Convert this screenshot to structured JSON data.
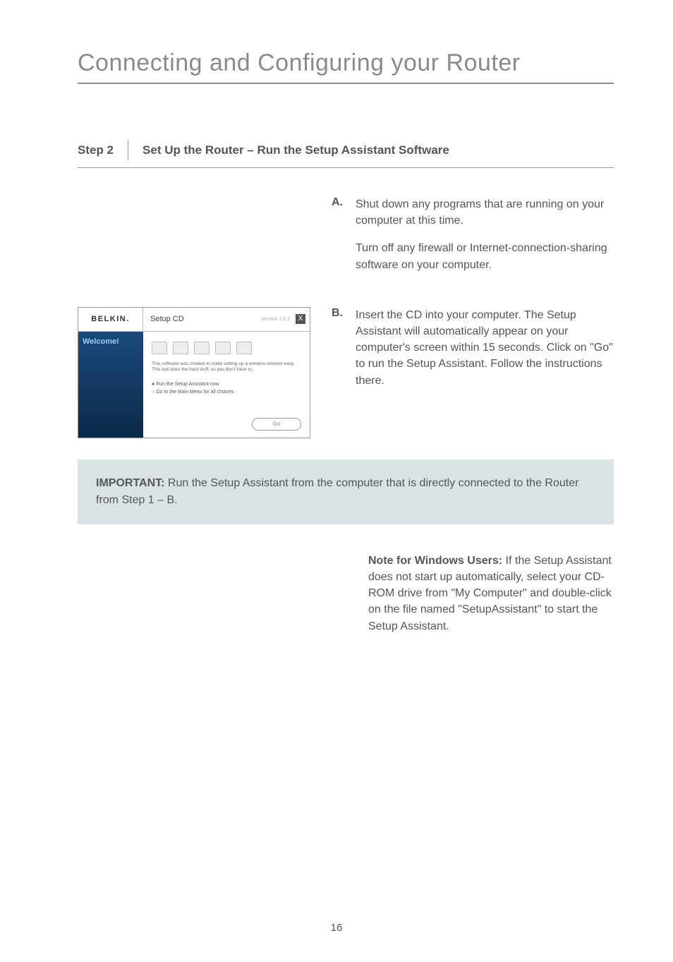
{
  "title": "Connecting and Configuring your Router",
  "step": {
    "label": "Step 2",
    "title": "Set Up the Router – Run the Setup Assistant Software"
  },
  "itemA": {
    "letter": "A.",
    "p1": "Shut down any programs that are running on your computer at this time.",
    "p2": "Turn off any firewall or Internet-connection-sharing software on your computer."
  },
  "itemB": {
    "letter": "B.",
    "text": "Insert the CD into your computer. The Setup Assistant will automatically appear on your computer's screen within 15 seconds. Click on \"Go\" to run the Setup Assistant. Follow the instructions there."
  },
  "mock": {
    "brand": "BELKIN.",
    "tab": "Setup CD",
    "version": "Version 1.0.1",
    "close": "X",
    "welcome": "Welcome!",
    "desc": "This software was created to make setting up a wireless network easy. This tool does the hard stuff, so you don't have to.",
    "opt1": "Run the Setup Assistant now",
    "opt2": "Go to the Main Menu for all choices",
    "go": "Go"
  },
  "callout": {
    "label": "IMPORTANT:",
    "text": " Run the Setup Assistant from the computer that is directly connected to the Router from Step 1 – B."
  },
  "note": {
    "label": "Note for Windows Users:",
    "text": " If the Setup Assistant does not start up automatically, select your CD-ROM drive from \"My Computer\" and double-click on the file named \"SetupAssistant\" to start the Setup Assistant."
  },
  "page_number": "16"
}
